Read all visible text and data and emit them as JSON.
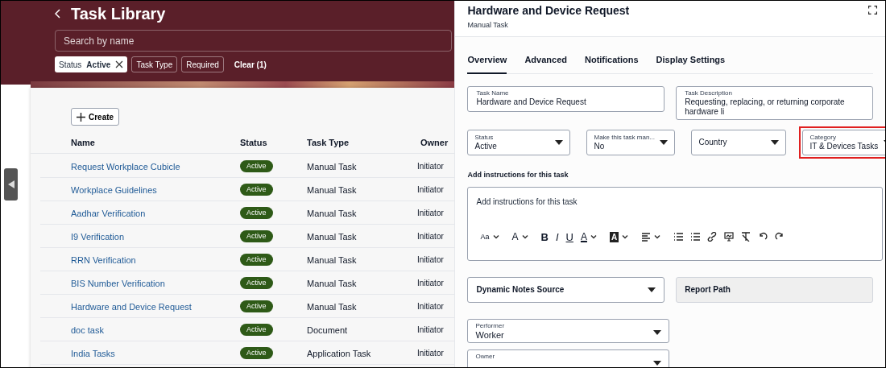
{
  "library": {
    "title": "Task Library",
    "search": {
      "placeholder": "Search by name"
    },
    "filters": [
      {
        "kind": "applied",
        "label": "Status",
        "value": "Active"
      },
      {
        "kind": "chip",
        "label": "Task Type"
      },
      {
        "kind": "chip",
        "label": "Required"
      },
      {
        "kind": "clear",
        "label": "Clear (1)"
      }
    ],
    "create_button": "Create",
    "table": {
      "columns": [
        "Name",
        "Status",
        "Task Type",
        "Owner"
      ],
      "rows": [
        {
          "name": "Request Workplace Cubicle",
          "status": "Active",
          "task_type": "Manual Task",
          "owner": "Initiator"
        },
        {
          "name": "Workplace Guidelines",
          "status": "Active",
          "task_type": "Manual Task",
          "owner": "Initiator"
        },
        {
          "name": "Aadhar Verification",
          "status": "Active",
          "task_type": "Manual Task",
          "owner": "Initiator"
        },
        {
          "name": "I9 Verification",
          "status": "Active",
          "task_type": "Manual Task",
          "owner": "Initiator"
        },
        {
          "name": "RRN Verification",
          "status": "Active",
          "task_type": "Manual Task",
          "owner": "Initiator"
        },
        {
          "name": "BIS Number Verification",
          "status": "Active",
          "task_type": "Manual Task",
          "owner": "Initiator"
        },
        {
          "name": "Hardware and Device Request",
          "status": "Active",
          "task_type": "Manual Task",
          "owner": "Initiator"
        },
        {
          "name": "doc task",
          "status": "Active",
          "task_type": "Document",
          "owner": "Initiator"
        },
        {
          "name": "India Tasks",
          "status": "Active",
          "task_type": "Application Task",
          "owner": "Initiator"
        }
      ]
    }
  },
  "detail": {
    "title": "Hardware and Device Request",
    "subtitle": "Manual Task",
    "tabs": [
      {
        "label": "Overview",
        "selected": true
      },
      {
        "label": "Advanced",
        "selected": false
      },
      {
        "label": "Notifications",
        "selected": false
      },
      {
        "label": "Display Settings",
        "selected": false
      }
    ],
    "text_fields": [
      {
        "label": "Task Name",
        "value": "Hardware and Device Request"
      },
      {
        "label": "Task Description",
        "value": "Requesting, replacing, or returning corporate hardware li"
      }
    ],
    "selects": [
      {
        "label": "Status",
        "value": "Active",
        "highlighted": false
      },
      {
        "label": "Make this task man...",
        "value": "No",
        "highlighted": false
      },
      {
        "label": "Country",
        "highlighted": false
      },
      {
        "label": "Category",
        "value": "IT & Devices Tasks",
        "highlighted": true
      }
    ],
    "instructions": {
      "label": "Add instructions for this task",
      "placeholder": "Add instructions for this task",
      "toolbar": [
        {
          "kind": "font-size",
          "label": "Aa"
        },
        {
          "kind": "line-height",
          "label": "A"
        },
        {
          "kind": "bold",
          "label": "B"
        },
        {
          "kind": "italic",
          "label": "I"
        },
        {
          "kind": "underline",
          "label": "U"
        },
        {
          "kind": "text-color",
          "label": "A"
        },
        {
          "kind": "highlight",
          "label": "A"
        },
        {
          "kind": "align"
        },
        {
          "kind": "bullets"
        },
        {
          "kind": "numbering"
        },
        {
          "kind": "link"
        },
        {
          "kind": "image"
        },
        {
          "kind": "clear-format"
        },
        {
          "kind": "undo"
        },
        {
          "kind": "redo"
        }
      ]
    },
    "lower_fields": [
      {
        "kind": "select",
        "label": "Dynamic Notes Source",
        "disabled": false
      },
      {
        "kind": "input",
        "label": "Report Path",
        "disabled": true
      }
    ],
    "person_fields": [
      {
        "label": "Performer",
        "value": "Worker"
      },
      {
        "label": "Owner"
      }
    ]
  }
}
